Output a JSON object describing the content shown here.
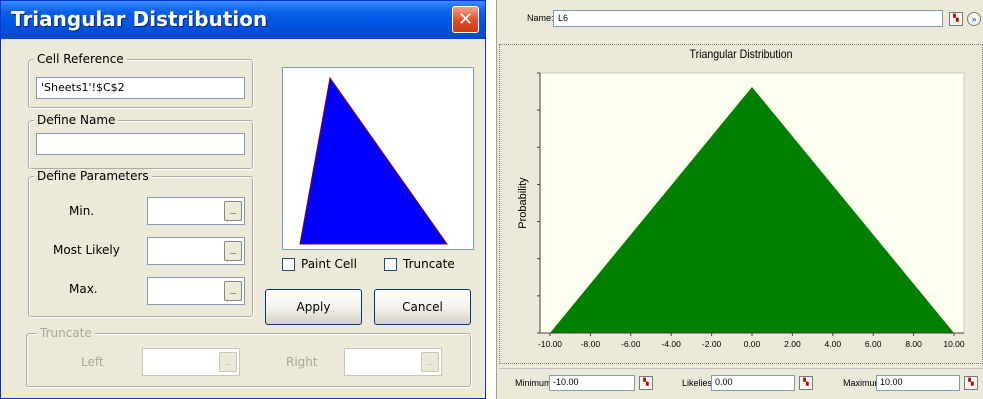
{
  "dialog": {
    "title": "Triangular Distribution",
    "close_glyph": "✕",
    "cell_reference": {
      "label": "Cell Reference",
      "value": "'Sheets1'!$C$2"
    },
    "define_name": {
      "label": "Define Name",
      "value": ""
    },
    "define_parameters": {
      "label": "Define Parameters",
      "min_label": "Min.",
      "most_likely_label": "Most Likely",
      "max_label": "Max.",
      "min_value": "",
      "most_likely_value": "",
      "max_value": "",
      "picker_glyph": "_"
    },
    "preview": {
      "fill_color": "#0000ff",
      "edge_color": "#8b0000"
    },
    "paint_cell_label": "Paint Cell",
    "truncate_label": "Truncate",
    "apply_label": "Apply",
    "cancel_label": "Cancel",
    "truncate_group": {
      "label": "Truncate",
      "left_label": "Left",
      "right_label": "Right",
      "left_value": "",
      "right_value": ""
    }
  },
  "panel": {
    "name_label": "Name:",
    "name_value": "L6",
    "expand_glyph": "»",
    "minimum_label": "Minimum",
    "minimum_value": "-10.00",
    "likeliest_label": "Likeliest",
    "likeliest_value": "0.00",
    "maximum_label": "Maximum",
    "maximum_value": "10.00"
  },
  "chart_data": {
    "type": "area",
    "title": "Triangular Distribution",
    "ylabel": "Probability",
    "xlabel": "",
    "x": [
      -10.0,
      0.0,
      10.0
    ],
    "y": [
      0,
      1,
      0
    ],
    "xlim": [
      -10.0,
      10.0
    ],
    "x_tick_labels": [
      "-10.00",
      "-8.00",
      "-6.00",
      "-4.00",
      "-2.00",
      "0.00",
      "2.00",
      "4.00",
      "6.00",
      "8.00",
      "10.00"
    ],
    "fill_color": "#008000",
    "plot_background": "#fffff0",
    "grid": false
  }
}
